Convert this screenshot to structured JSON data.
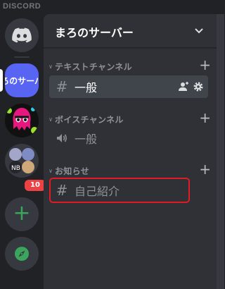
{
  "app": {
    "brand": "DISCORD"
  },
  "rail": {
    "active_server_label": "ろのサーバ",
    "badge": "10",
    "add_label": "+"
  },
  "server": {
    "name": "まろのサーバー"
  },
  "categories": [
    {
      "label": "テキストチャンネル",
      "add": "+"
    },
    {
      "label": "ボイスチャンネル",
      "add": "+"
    },
    {
      "label": "お知らせ",
      "add": "+"
    }
  ],
  "channels": {
    "text_general": "一般",
    "voice_general": "一般",
    "intro": "自己紹介"
  },
  "icons": {
    "text_channel": "hash-icon",
    "voice_channel": "speaker-icon",
    "invite": "add-member-icon",
    "settings": "gear-icon"
  },
  "colors": {
    "blurple": "#5865f2",
    "green": "#3ba55d",
    "red": "#ed4245",
    "highlight": "#e01b24"
  }
}
